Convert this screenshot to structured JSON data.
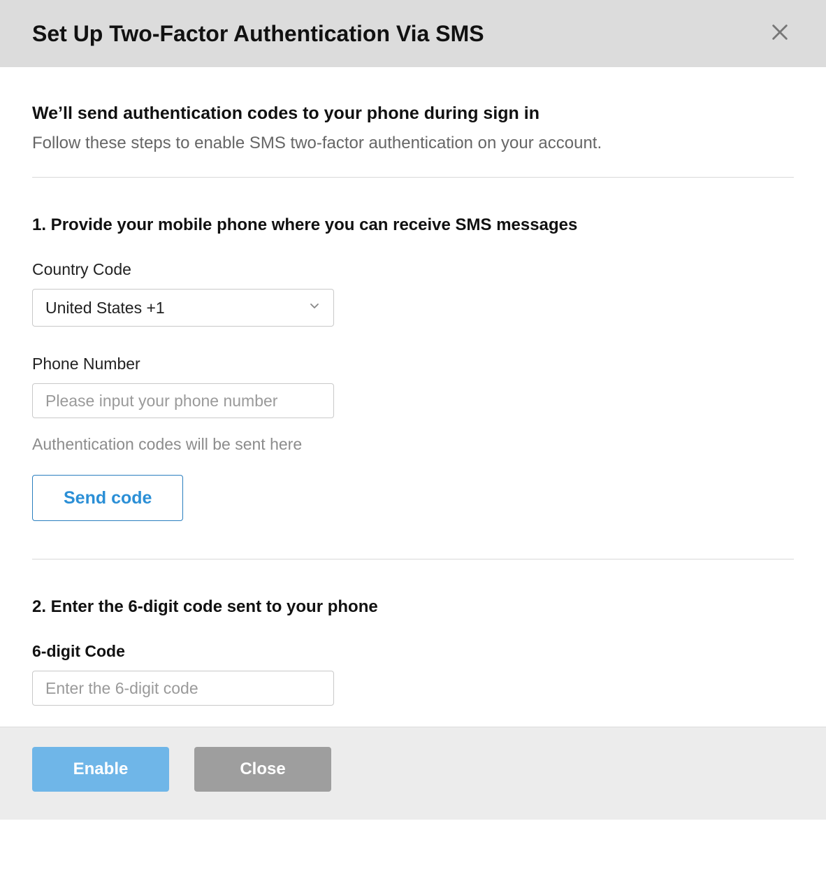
{
  "header": {
    "title": "Set Up Two-Factor Authentication Via SMS"
  },
  "intro": {
    "heading": "We’ll send authentication codes to your phone during sign in",
    "sub": "Follow these steps to enable SMS two-factor authentication on your account."
  },
  "step1": {
    "heading": "1. Provide your mobile phone where you can receive SMS messages",
    "country_label": "Country Code",
    "country_selected": "United States +1",
    "phone_label": "Phone Number",
    "phone_placeholder": "Please input your phone number",
    "phone_value": "",
    "helper": "Authentication codes will be sent here",
    "send_button": "Send code"
  },
  "step2": {
    "heading": "2. Enter the 6-digit code sent to your phone",
    "code_label": "6-digit Code",
    "code_placeholder": "Enter the 6-digit code",
    "code_value": ""
  },
  "footer": {
    "enable": "Enable",
    "close": "Close"
  }
}
